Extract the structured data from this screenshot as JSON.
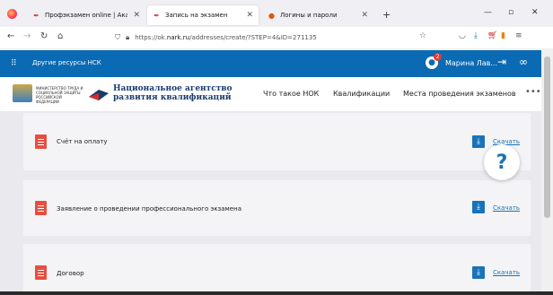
{
  "browser": {
    "tabs": [
      {
        "label": "Профэкзамен online | Академ",
        "icon": "tab-favicon"
      },
      {
        "label": "Запись на экзамен",
        "icon": "tab-favicon"
      },
      {
        "label": "Логины и пароли",
        "icon": "tab-favicon"
      }
    ],
    "new_tab": "+",
    "url_prefix": "https://ok.",
    "url_host": "nark.ru",
    "url_path": "/addresses/create/?STEP=4&ID=271135"
  },
  "site": {
    "other_resources": "Другие ресурсы НСК",
    "user_name": "Марина Лав...",
    "notification_count": "2",
    "ministry_text": "МИНИСТЕРСТВО ТРУДА И СОЦИАЛЬНОЙ ЗАЩИТЫ РОССИЙСКОЙ ФЕДЕРАЦИИ",
    "agency_line1": "Национальное агентство",
    "agency_line2": "развития квалификаций",
    "menu": [
      "Что такое НОК",
      "Квалификации",
      "Места проведения экзаменов"
    ],
    "menu_more": "•••"
  },
  "documents": [
    {
      "title": "Счёт на оплату",
      "download": "Скачать"
    },
    {
      "title": "Заявление о проведении профессионального экзамена",
      "download": "Скачать"
    },
    {
      "title": "Договор",
      "download": "Скачать"
    }
  ],
  "help_label": "?",
  "colors": {
    "brand_blue": "#0a6ab3",
    "doc_red": "#e84e40",
    "link_blue": "#1a73b8"
  }
}
